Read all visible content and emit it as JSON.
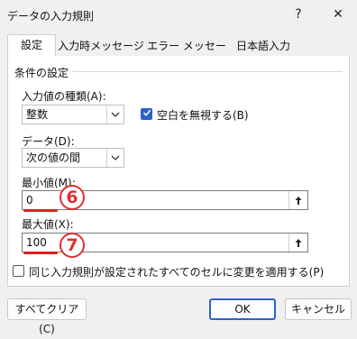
{
  "window": {
    "title": "データの入力規則",
    "help_glyph": "?",
    "close_glyph": "✕"
  },
  "tabs": [
    {
      "label": "設定",
      "active": true
    },
    {
      "label": "入力時メッセージ",
      "active": false
    },
    {
      "label": "エラー メッセージ",
      "active": false
    },
    {
      "label": "日本語入力",
      "active": false
    }
  ],
  "conditions": {
    "group_label": "条件の設定",
    "allow_label": "入力値の種類(A):",
    "allow_value": "整数",
    "ignore_blank_label": "空白を無視する(B)",
    "ignore_blank_checked": true,
    "data_label": "データ(D):",
    "data_value": "次の値の間",
    "min_label": "最小値(M):",
    "min_value": "0",
    "max_label": "最大値(X):",
    "max_value": "100"
  },
  "apply_all_label": "同じ入力規則が設定されたすべてのセルに変更を適用する(P)",
  "apply_all_checked": false,
  "buttons": {
    "clear_all": "すべてクリア(C)",
    "ok": "OK",
    "cancel": "キャンセル"
  },
  "annotations": {
    "marker_min": "6",
    "marker_max": "7",
    "accent_color": "#e02020"
  },
  "icons": {
    "dropdown": "chevron-down-icon",
    "collapse": "range-select-icon",
    "check": "check-icon"
  }
}
